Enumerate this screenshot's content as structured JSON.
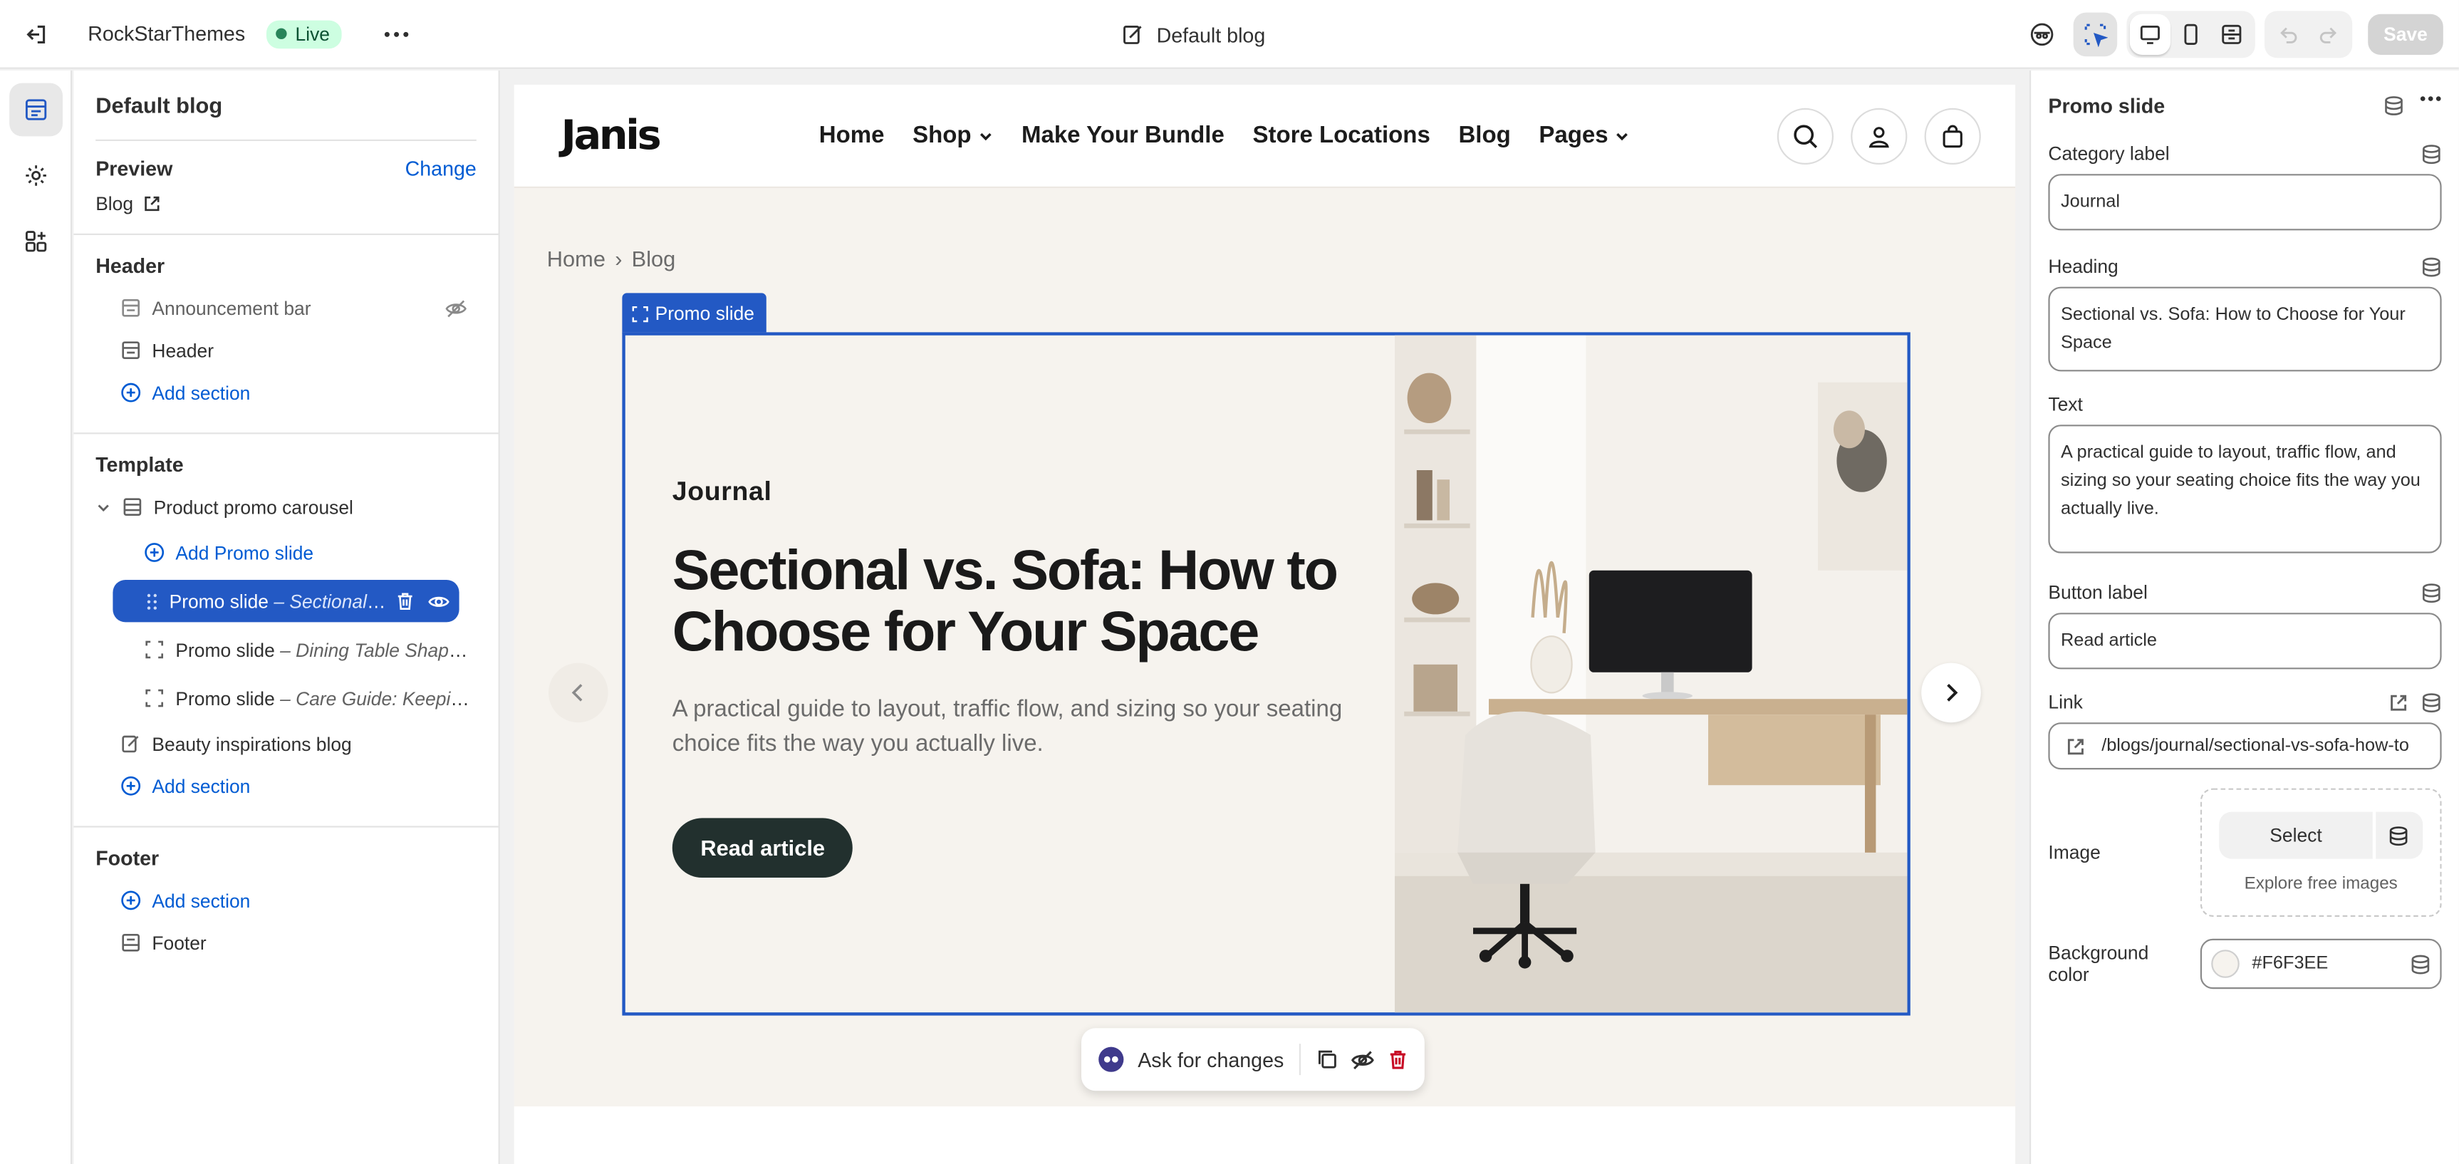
{
  "topbar": {
    "store_name": "RockStarThemes",
    "status": "Live",
    "page_name": "Default blog",
    "save_label": "Save"
  },
  "left": {
    "title": "Default blog",
    "preview_label": "Preview",
    "change_label": "Change",
    "preview_value": "Blog",
    "header_group": "Header",
    "header_items": [
      "Announcement bar",
      "Header"
    ],
    "add_section": "Add section",
    "template_group": "Template",
    "carousel_label": "Product promo carousel",
    "add_promo_slide": "Add Promo slide",
    "slides": [
      {
        "name": "Promo slide",
        "detail": " – Sectional vs. Sofa: How to Choose for Your Space"
      },
      {
        "name": "Promo slide",
        "detail": " – Dining Table Shapes: Round vs. Rectangular"
      },
      {
        "name": "Promo slide",
        "detail": " – Care Guide: Keeping Your Furniture Looking New"
      }
    ],
    "beauty_blog": "Beauty inspirations blog",
    "footer_group": "Footer",
    "footer_item": "Footer"
  },
  "preview": {
    "logo": "Janis",
    "nav": [
      "Home",
      "Shop",
      "Make Your Bundle",
      "Store Locations",
      "Blog",
      "Pages"
    ],
    "breadcrumb_home": "Home",
    "breadcrumb_sep": "›",
    "breadcrumb_current": "Blog",
    "slide_tag": "Promo slide",
    "ask_label": "Ask for changes"
  },
  "right": {
    "title": "Promo slide",
    "category_label": "Category label",
    "category_value": "Journal",
    "heading_label": "Heading",
    "heading_value": "Sectional vs. Sofa: How to Choose for Your Space",
    "text_label": "Text",
    "text_value": "A practical guide to layout, traffic flow, and sizing so your seating choice fits the way you actually live.",
    "button_label_label": "Button label",
    "button_label_value": "Read article",
    "link_label": "Link",
    "link_value": "/blogs/journal/sectional-vs-sofa-how-to",
    "image_label": "Image",
    "select_label": "Select",
    "explore_label": "Explore free images",
    "bg_label": "Background color",
    "bg_value": "#F6F3EE"
  },
  "colors": {
    "accent": "#2359c4",
    "link": "#005bd3",
    "live_bg": "#cdfee1",
    "slide_bg": "#F6F3EE",
    "cta_bg": "#22302e"
  },
  "icons": [
    "exit-icon",
    "more-icon",
    "edit-page-icon",
    "sidekick-icon",
    "inspect-icon",
    "desktop-icon",
    "mobile-icon",
    "fullwidth-icon",
    "undo-icon",
    "redo-icon",
    "sections-icon",
    "settings-icon",
    "apps-icon",
    "external-link-icon",
    "eye-off-icon",
    "eye-icon",
    "trash-icon",
    "drag-handle-icon",
    "plus-circle-icon",
    "chevron-down-icon",
    "search-icon",
    "account-icon",
    "bag-icon",
    "chevron-left-icon",
    "chevron-right-icon",
    "duplicate-icon",
    "database-icon",
    "link-icon"
  ]
}
